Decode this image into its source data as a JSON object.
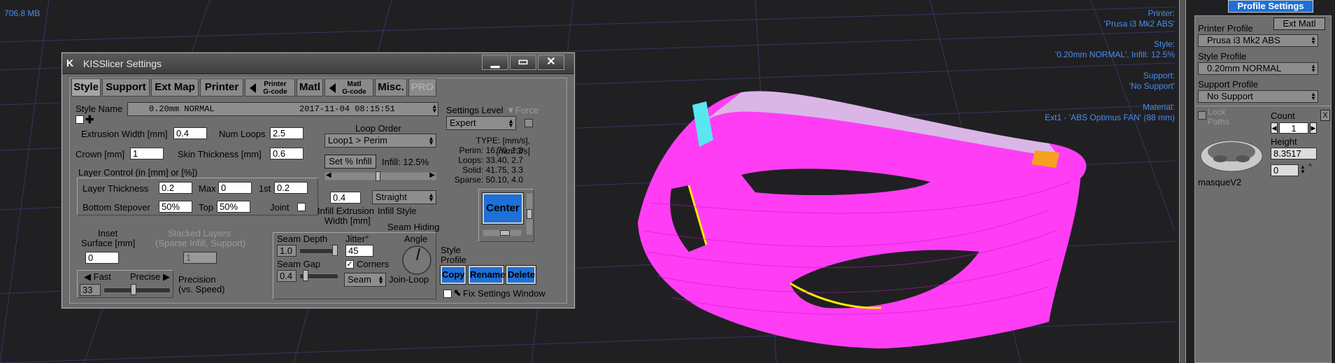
{
  "viewport": {
    "memory": "706.8 MB",
    "printer_label": "Printer:",
    "printer_value": "'Prusa i3 Mk2 ABS'",
    "style_label": "Style:",
    "style_value": "'0.20mm NORMAL', Infill: 12.5%",
    "support_label": "Support:",
    "support_value": "'No Support'",
    "material_label": "Material:",
    "material_value": "Ext1 - 'ABS Optimus FAN' (88 mm)"
  },
  "window": {
    "title": "KISSlicer Settings",
    "minimize": "▁",
    "maximize": "▭",
    "close": "✕"
  },
  "tabs": {
    "style": "Style",
    "support": "Support",
    "extmap": "Ext Map",
    "printer": "Printer",
    "printer_gcode_1": "Printer",
    "printer_gcode_2": "G-code",
    "matl": "Matl",
    "matl_gcode_1": "Matl",
    "matl_gcode_2": "G-code",
    "misc": "Misc.",
    "pro": "PRO"
  },
  "style": {
    "style_name_label": "Style Name",
    "style_name_value": "0.20mm NORMAL",
    "style_date": "2017-11-04 08:15:51",
    "add_icon": "✚",
    "extrusion_width_label": "Extrusion Width [mm]",
    "extrusion_width_value": "0.4",
    "num_loops_label": "Num Loops",
    "num_loops_value": "2.5",
    "crown_label": "Crown [mm]",
    "crown_value": "1",
    "skin_thickness_label": "Skin Thickness [mm]",
    "skin_thickness_value": "0.6",
    "layer_control_label": "Layer Control (in [mm] or [%])",
    "layer_thickness_label": "Layer Thickness",
    "layer_thickness_value": "0.2",
    "max_label": "Max",
    "max_value": "0",
    "first_label": "1st",
    "first_value": "0.2",
    "bottom_stepover_label": "Bottom Stepover",
    "bottom_stepover_value": "50%",
    "top_label": "Top",
    "top_value": "50%",
    "joint_label": "Joint",
    "inset_label_1": "Inset",
    "inset_label_2": "Surface [mm]",
    "inset_value": "0",
    "stacked_label_1": "Stacked Layers",
    "stacked_label_2": "(Sparse Infill, Support)",
    "stacked_value": "1",
    "fast_label": "Fast",
    "precise_label": "Precise",
    "precision_value": "33",
    "precision_label_1": "Precision",
    "precision_label_2": "(vs. Speed)",
    "loop_order_label": "Loop Order",
    "loop_order_value": "Loop1 > Perim",
    "set_infill_button": "Set % Infill",
    "infill_label": "Infill: 12.5%",
    "infill_fraction": 0.45,
    "infill_extrusion_value": "0.4",
    "infill_style_value": "Straight",
    "infill_extrusion_label_1": "Infill Extrusion",
    "infill_extrusion_label_2": "Width [mm]",
    "infill_style_label": "Infill Style",
    "seam_hiding_label": "Seam Hiding",
    "seam_depth_label": "Seam Depth",
    "seam_depth_value": "1.0",
    "jitter_label": "Jitter°",
    "jitter_value": "45",
    "angle_label": "Angle",
    "seam_gap_label": "Seam Gap",
    "seam_gap_value": "0.4",
    "corners_label": "Corners",
    "seam_select_value": "Seam",
    "join_loop_label": "Join-Loop"
  },
  "settings": {
    "level_label": "Settings Level",
    "force_label": "Force",
    "level_value": "Expert",
    "type_header": "TYPE: [mm/s], [mm^3/s]",
    "perim": "Perim:   16.70,  1.3",
    "loops": "Loops:   33.40,  2.7",
    "solid": "Solid:   41.75,  3.3",
    "sparse": "Sparse:  50.10,  4.0",
    "center_button": "Center",
    "style_profile_label_1": "Style",
    "style_profile_label_2": "Profile",
    "copy_button": "Copy",
    "rename_button": "Rename",
    "delete_button": "Delete",
    "fix_window_label": "Fix Settings Window"
  },
  "right_panel": {
    "header": "Profile Settings",
    "ext_matl_button": "Ext Matl",
    "printer_profile_label": "Printer Profile",
    "printer_profile_value": "Prusa i3 Mk2 ABS",
    "style_profile_label": "Style Profile",
    "style_profile_value": "0.20mm NORMAL",
    "support_profile_label": "Support Profile",
    "support_profile_value": "No Support",
    "lock_label_1": "Lock",
    "lock_label_2": "Paths",
    "count_label": "Count",
    "count_value": "1",
    "height_label": "Height",
    "height_value": "8.3517",
    "rotation_value": "0",
    "degree_symbol": "°",
    "close_x": "X",
    "model_name": "masqueV2"
  },
  "colors": {
    "accent": "#1e6fd6",
    "overlay_text": "#4a8df0",
    "model_magenta": "#ff3df5",
    "model_orange": "#f6a020",
    "model_cyan": "#58e6ef"
  }
}
